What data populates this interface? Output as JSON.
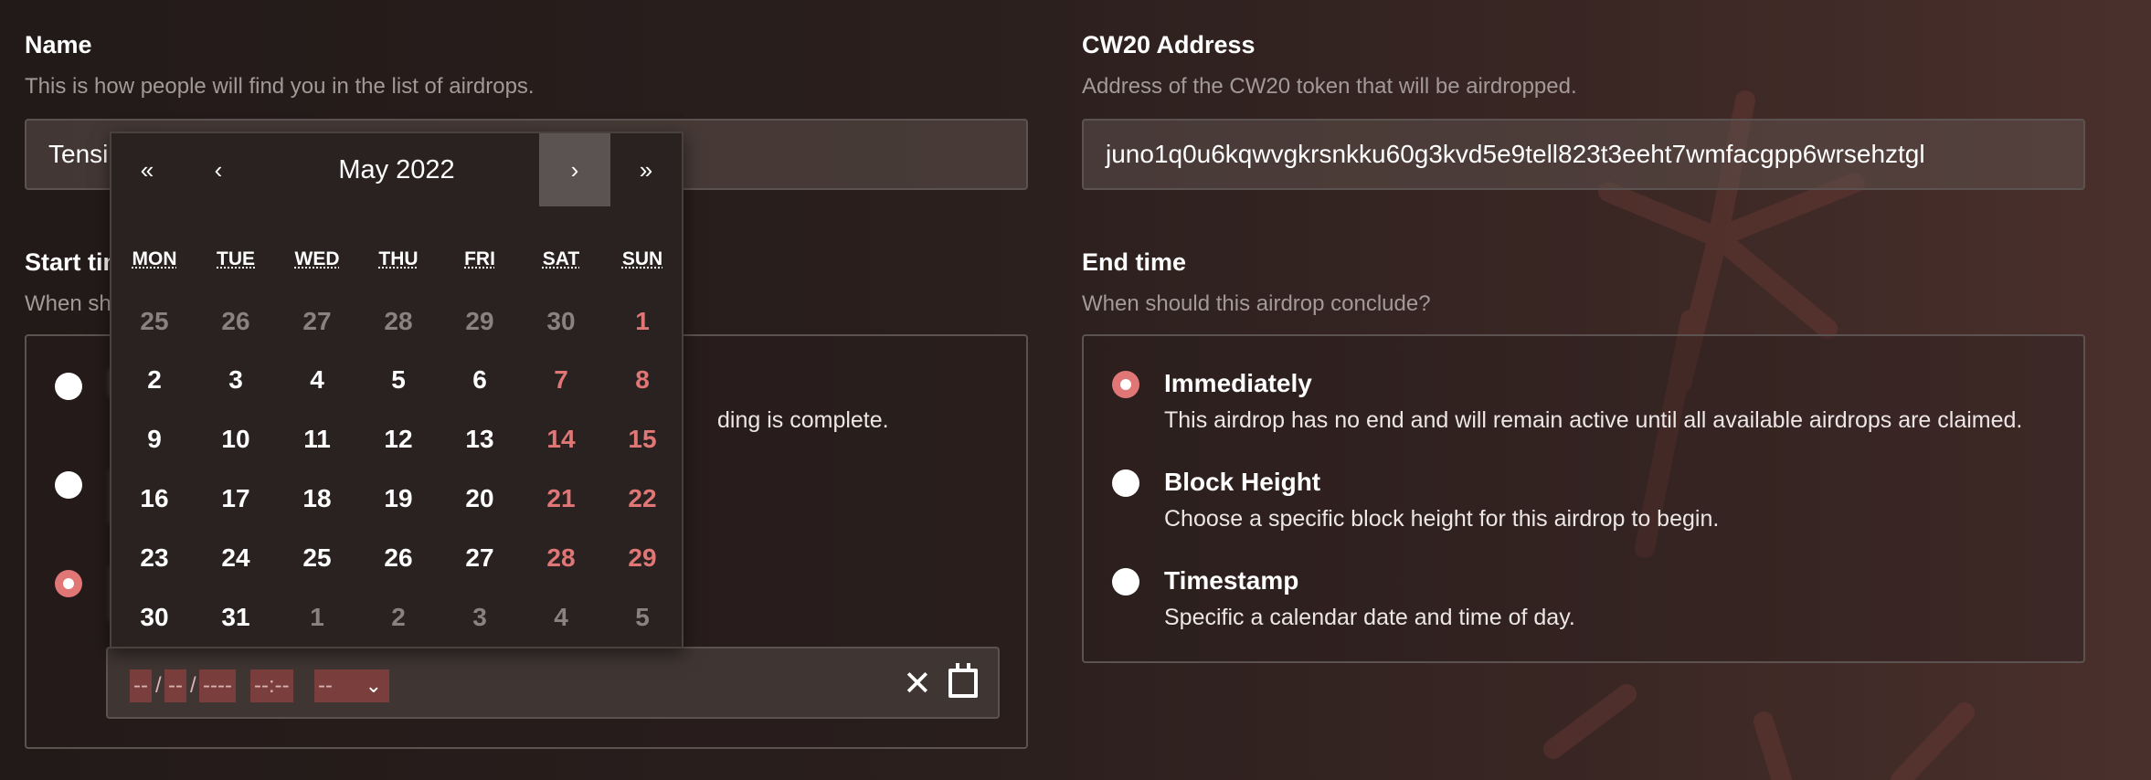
{
  "name_field": {
    "title": "Name",
    "description": "This is how people will find you in the list of airdrops.",
    "value": "Tensi"
  },
  "cw20_field": {
    "title": "CW20 Address",
    "description": "Address of the CW20 token that will be airdropped.",
    "value": "juno1q0u6kqwvgkrsnkku60g3kvd5e9tell823t3eeht7wmfacgpp6wrsehztgl"
  },
  "start_time": {
    "title_visible": "Start tim",
    "desc_visible": "When sh",
    "option1_desc_tail": "ding is complete."
  },
  "end_time": {
    "title": "End time",
    "description": "When should this airdrop conclude?",
    "options": [
      {
        "label": "Immediately",
        "description": "This airdrop has no end and will remain active until all available airdrops are claimed.",
        "selected": true
      },
      {
        "label": "Block Height",
        "description": "Choose a specific block height for this airdrop to begin.",
        "selected": false
      },
      {
        "label": "Timestamp",
        "description": "Specific a calendar date and time of day.",
        "selected": false
      }
    ]
  },
  "datetime_input": {
    "month_seg": "--",
    "day_seg": "--",
    "year_seg": "----",
    "hour_min": "--:--",
    "ampm": "--",
    "clear_icon": "close-icon",
    "calendar_icon": "calendar-icon"
  },
  "calendar": {
    "month_label": "May 2022",
    "prev_year": "«",
    "prev_month": "‹",
    "next_month": "›",
    "next_year": "»",
    "weekdays": [
      "MON",
      "TUE",
      "WED",
      "THU",
      "FRI",
      "SAT",
      "SUN"
    ],
    "weeks": [
      [
        "25",
        "26",
        "27",
        "28",
        "29",
        "30",
        "1"
      ],
      [
        "2",
        "3",
        "4",
        "5",
        "6",
        "7",
        "8"
      ],
      [
        "9",
        "10",
        "11",
        "12",
        "13",
        "14",
        "15"
      ],
      [
        "16",
        "17",
        "18",
        "19",
        "20",
        "21",
        "22"
      ],
      [
        "23",
        "24",
        "25",
        "26",
        "27",
        "28",
        "29"
      ],
      [
        "30",
        "31",
        "1",
        "2",
        "3",
        "4",
        "5"
      ]
    ]
  },
  "colors": {
    "accent": "#e07676",
    "background": "#2a1f1d"
  }
}
